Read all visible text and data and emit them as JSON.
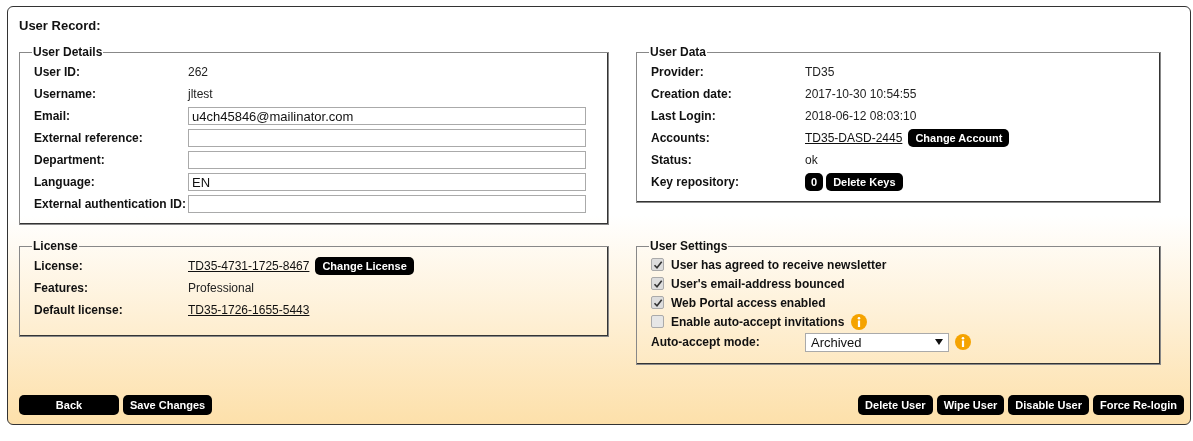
{
  "title": "User Record:",
  "user_details": {
    "legend": "User Details",
    "rows": [
      {
        "label": "User ID:",
        "kind": "text",
        "value": "262"
      },
      {
        "label": "Username:",
        "kind": "text",
        "value": "jltest"
      },
      {
        "label": "Email:",
        "kind": "field",
        "value": "u4ch45846@mailinator.com"
      },
      {
        "label": "External reference:",
        "kind": "field"
      },
      {
        "label": "Department:",
        "kind": "field"
      },
      {
        "label": "Language:",
        "kind": "field",
        "value": "EN"
      },
      {
        "label": "External authentication ID:",
        "kind": "field"
      }
    ]
  },
  "user_data": {
    "legend": "User Data",
    "rows": [
      {
        "label": "Provider:",
        "kind": "text",
        "value": "TD35"
      },
      {
        "label": "Creation date:",
        "kind": "text",
        "value": "2017-10-30 10:54:55"
      },
      {
        "label": "Last Login:",
        "kind": "text",
        "value": "2018-06-12 08:03:10"
      },
      {
        "label": "Accounts:",
        "kind": "link",
        "value": "TD35-DASD-2445",
        "button": "Change Account"
      },
      {
        "label": "Status:",
        "kind": "text",
        "value": "ok"
      },
      {
        "label": "Key repository:",
        "kind": "count",
        "value": "0",
        "button": "Delete Keys"
      }
    ]
  },
  "license": {
    "legend": "License",
    "rows": [
      {
        "label": "License:",
        "kind": "link",
        "value": "TD35-4731-1725-8467",
        "button": "Change License"
      },
      {
        "label": "Features:",
        "kind": "text",
        "value": "Professional"
      },
      {
        "label": "Default license:",
        "kind": "link",
        "value": "TD35-1726-1655-5443"
      }
    ]
  },
  "user_settings": {
    "legend": "User Settings",
    "checkboxes": [
      {
        "label": "User has agreed to receive newsletter",
        "checked": true,
        "info": false
      },
      {
        "label": "User's email-address bounced",
        "checked": true,
        "info": false
      },
      {
        "label": "Web Portal access enabled",
        "checked": true,
        "info": false
      },
      {
        "label": "Enable auto-accept invitations",
        "checked": false,
        "info": true
      }
    ],
    "auto_accept": {
      "label": "Auto-accept mode:",
      "value": "Archived",
      "info": true
    }
  },
  "buttons_left": [
    "Back",
    "Save Changes"
  ],
  "buttons_right": [
    "Delete User",
    "Wipe User",
    "Disable User",
    "Force Re-login"
  ]
}
